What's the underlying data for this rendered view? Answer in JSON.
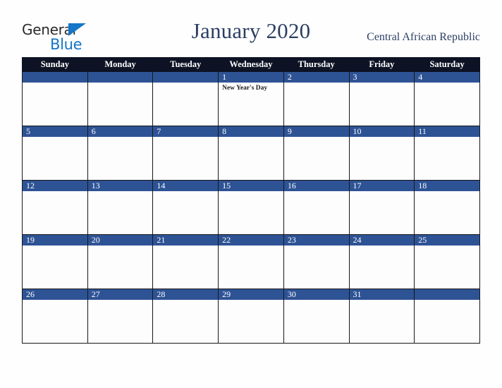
{
  "brand": {
    "name_part1": "General",
    "name_part2": "Blue",
    "triangle_color": "#1476c6",
    "text_color": "#2b2b2b"
  },
  "header": {
    "title": "January 2020",
    "country": "Central African Republic",
    "title_color": "#2c3f62"
  },
  "calendar": {
    "weekday_headers": [
      "Sunday",
      "Monday",
      "Tuesday",
      "Wednesday",
      "Thursday",
      "Friday",
      "Saturday"
    ],
    "header_bg": "#0d1324",
    "daynum_bg": "#2e5395",
    "weeks": [
      [
        {
          "day": "",
          "events": []
        },
        {
          "day": "",
          "events": []
        },
        {
          "day": "",
          "events": []
        },
        {
          "day": "1",
          "events": [
            "New Year's Day"
          ]
        },
        {
          "day": "2",
          "events": []
        },
        {
          "day": "3",
          "events": []
        },
        {
          "day": "4",
          "events": []
        }
      ],
      [
        {
          "day": "5",
          "events": []
        },
        {
          "day": "6",
          "events": []
        },
        {
          "day": "7",
          "events": []
        },
        {
          "day": "8",
          "events": []
        },
        {
          "day": "9",
          "events": []
        },
        {
          "day": "10",
          "events": []
        },
        {
          "day": "11",
          "events": []
        }
      ],
      [
        {
          "day": "12",
          "events": []
        },
        {
          "day": "13",
          "events": []
        },
        {
          "day": "14",
          "events": []
        },
        {
          "day": "15",
          "events": []
        },
        {
          "day": "16",
          "events": []
        },
        {
          "day": "17",
          "events": []
        },
        {
          "day": "18",
          "events": []
        }
      ],
      [
        {
          "day": "19",
          "events": []
        },
        {
          "day": "20",
          "events": []
        },
        {
          "day": "21",
          "events": []
        },
        {
          "day": "22",
          "events": []
        },
        {
          "day": "23",
          "events": []
        },
        {
          "day": "24",
          "events": []
        },
        {
          "day": "25",
          "events": []
        }
      ],
      [
        {
          "day": "26",
          "events": []
        },
        {
          "day": "27",
          "events": []
        },
        {
          "day": "28",
          "events": []
        },
        {
          "day": "29",
          "events": []
        },
        {
          "day": "30",
          "events": []
        },
        {
          "day": "31",
          "events": []
        },
        {
          "day": "",
          "events": []
        }
      ]
    ]
  }
}
